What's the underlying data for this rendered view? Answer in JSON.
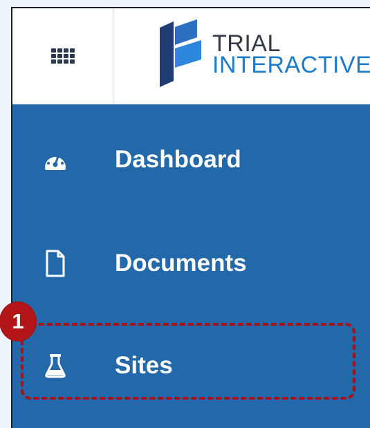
{
  "header": {
    "logo": {
      "line1": "TRIAL",
      "line2": "INTERACTIVE"
    },
    "apps_icon": "grid-icon"
  },
  "sidebar": {
    "items": [
      {
        "label": "Dashboard",
        "icon": "dashboard-icon"
      },
      {
        "label": "Documents",
        "icon": "document-icon"
      },
      {
        "label": "Sites",
        "icon": "flask-icon"
      }
    ]
  },
  "annotation": {
    "step_number": "1"
  },
  "colors": {
    "sidebar_background": "#2368a9",
    "highlight": "#a51318",
    "logo_blue": "#1c7cc9",
    "logo_dark": "#333a46"
  }
}
